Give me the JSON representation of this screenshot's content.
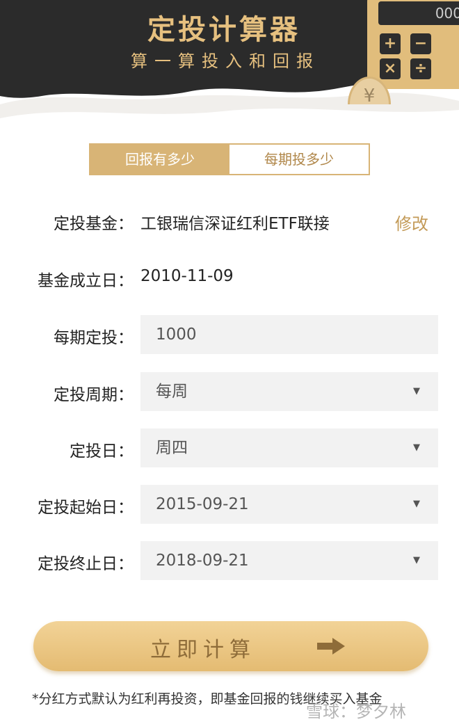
{
  "header": {
    "title": "定投计算器",
    "subtitle": "算一算投入和回报",
    "calculator_display": "000",
    "calculator_keys": [
      "+",
      "−",
      "×",
      "÷"
    ],
    "coin_symbol": "¥"
  },
  "tabs": [
    {
      "label": "回报有多少",
      "active": true
    },
    {
      "label": "每期投多少",
      "active": false
    }
  ],
  "fund": {
    "label": "定投基金：",
    "value": "工银瑞信深证红利ETF联接",
    "edit_label": "修改"
  },
  "inception": {
    "label": "基金成立日：",
    "value": "2010-11-09"
  },
  "amount": {
    "label": "每期定投：",
    "value": "1000"
  },
  "period": {
    "label": "定投周期：",
    "value": "每周"
  },
  "day": {
    "label": "定投日：",
    "value": "周四"
  },
  "start_date": {
    "label": "定投起始日：",
    "value": "2015-09-21"
  },
  "end_date": {
    "label": "定投终止日：",
    "value": "2018-09-21"
  },
  "calculate_button": {
    "label": "立即计算"
  },
  "footnote": "*分红方式默认为红利再投资，即基金回报的钱继续买入基金",
  "watermark": "雪球：梦夕林",
  "colors": {
    "gold": "#d8b476",
    "dark": "#2d2d2d",
    "field_bg": "#f2f2f2"
  }
}
